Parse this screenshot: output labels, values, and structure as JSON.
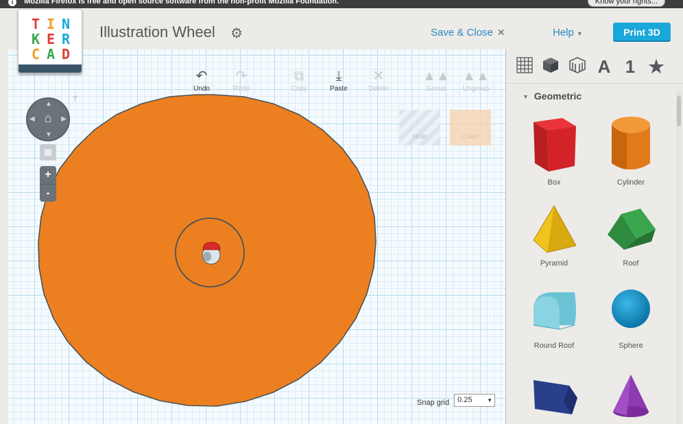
{
  "notice": {
    "text": "Mozilla Firefox is free and open source software from the non-profit Mozilla Foundation.",
    "button": "Know your rights..."
  },
  "logo": {
    "letters": [
      "T",
      "I",
      "N",
      "K",
      "E",
      "R",
      "C",
      "A",
      "D"
    ],
    "colors": [
      "#e13b34",
      "#f29c21",
      "#1aa7d9",
      "#3aa64e",
      "#e13b34",
      "#1aa7d9",
      "#f29c21",
      "#3aa64e",
      "#e13b34"
    ]
  },
  "header": {
    "title": "Illustration Wheel",
    "save_close": "Save & Close",
    "help": "Help",
    "print": "Print 3D"
  },
  "toolbar": {
    "undo": "Undo",
    "redo": "Redo",
    "copy": "Copy",
    "paste": "Paste",
    "delete": "Delete",
    "group": "Group",
    "ungroup": "Ungroup",
    "hole": "Hole",
    "color": "Color"
  },
  "help_hint": "?",
  "zoom": {
    "in": "+",
    "out": "-"
  },
  "snap": {
    "label": "Snap grid",
    "value": "0.25"
  },
  "panel": {
    "tabs": [
      "workplane-grid-icon",
      "box-icon",
      "hole-box-icon",
      "A",
      "1",
      "star-icon"
    ],
    "tab_letter": "A",
    "tab_number": "1",
    "section": "Geometric",
    "shapes": {
      "box": "Box",
      "cylinder": "Cylinder",
      "pyramid": "Pyramid",
      "roof": "Roof",
      "round_roof": "Round Roof",
      "sphere": "Sphere"
    }
  },
  "colors": {
    "accent": "#1aa7d9",
    "link": "#2a88c4",
    "wheel": "#ec8020",
    "grid": "#b7dcec"
  }
}
